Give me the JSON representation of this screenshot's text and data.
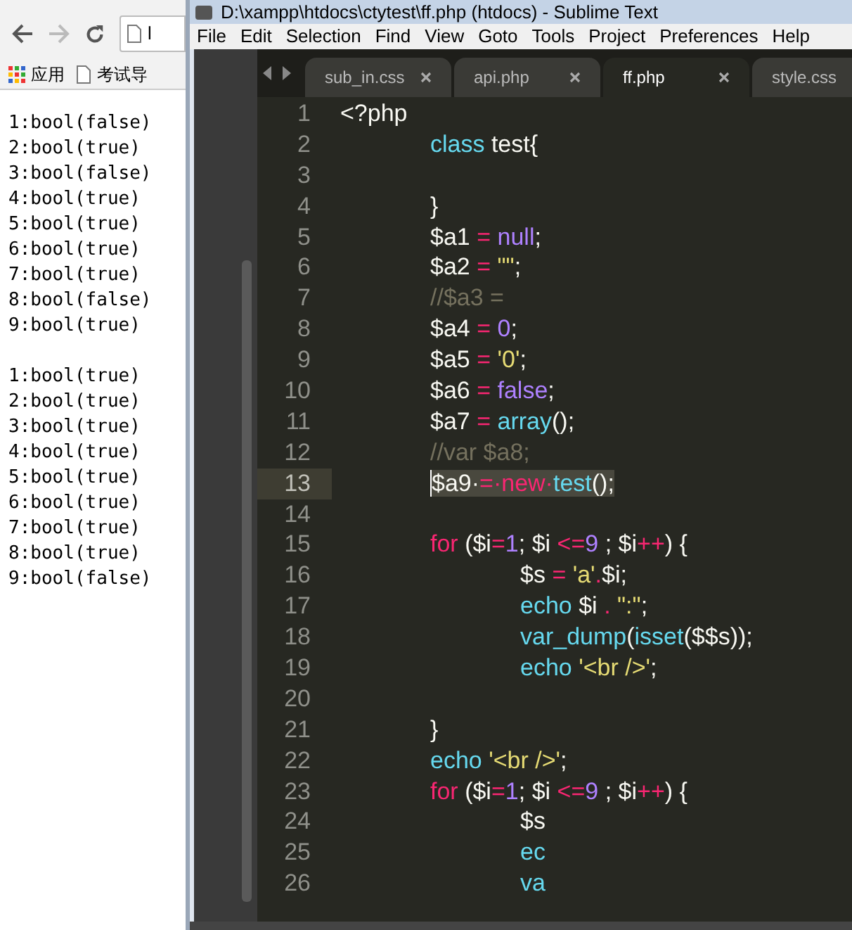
{
  "browser": {
    "url_partial": "l",
    "bookmarks": [
      {
        "label": "应用",
        "kind": "apps"
      },
      {
        "label": "考试导",
        "kind": "page"
      }
    ],
    "output_groups": [
      [
        "1:bool(false)",
        "2:bool(true)",
        "3:bool(false)",
        "4:bool(true)",
        "5:bool(true)",
        "6:bool(true)",
        "7:bool(true)",
        "8:bool(false)",
        "9:bool(true)"
      ],
      [
        "1:bool(true)",
        "2:bool(true)",
        "3:bool(true)",
        "4:bool(true)",
        "5:bool(true)",
        "6:bool(true)",
        "7:bool(true)",
        "8:bool(true)",
        "9:bool(false)"
      ]
    ]
  },
  "editor": {
    "window": {
      "title": "D:\\xampp\\htdocs\\ctytest\\ff.php (htdocs) - Sublime Text"
    },
    "menu": [
      "File",
      "Edit",
      "Selection",
      "Find",
      "View",
      "Goto",
      "Tools",
      "Project",
      "Preferences",
      "Help"
    ],
    "tabs": [
      {
        "label": "sub_in.css",
        "selected": false
      },
      {
        "label": "api.php",
        "selected": false
      },
      {
        "label": "ff.php",
        "selected": true
      },
      {
        "label": "style.css",
        "selected": false
      }
    ],
    "lines": [
      {
        "number": "1",
        "selected": false,
        "tokens": [
          {
            "text": "<?php",
            "kind": "plain"
          }
        ]
      },
      {
        "number": "2",
        "selected": false,
        "tokens": [
          {
            "text": "\tclass",
            "kind": "keyword"
          },
          {
            "text": " test{",
            "kind": "plain"
          }
        ]
      },
      {
        "number": "3",
        "selected": false
      },
      {
        "number": "4",
        "selected": false,
        "tokens": [
          {
            "text": "\t}",
            "kind": "plain"
          }
        ]
      },
      {
        "number": "5",
        "selected": false,
        "tokens": [
          {
            "text": "\t$a1 ",
            "kind": "plain"
          },
          {
            "text": "=",
            "kind": "operator"
          },
          {
            "text": " null",
            "kind": "constant"
          },
          {
            "text": ";",
            "kind": "plain"
          }
        ]
      },
      {
        "number": "6",
        "selected": false,
        "tokens": [
          {
            "text": "\t$a2 ",
            "kind": "plain"
          },
          {
            "text": "=",
            "kind": "operator"
          },
          {
            "text": " \"\"",
            "kind": "string"
          },
          {
            "text": ";",
            "kind": "plain"
          }
        ]
      },
      {
        "number": "7",
        "selected": false,
        "tokens": [
          {
            "text": "\t//$a3 =",
            "kind": "comment"
          }
        ]
      },
      {
        "number": "8",
        "selected": false,
        "tokens": [
          {
            "text": "\t$a4 ",
            "kind": "plain"
          },
          {
            "text": "=",
            "kind": "operator"
          },
          {
            "text": " 0",
            "kind": "constant"
          },
          {
            "text": ";",
            "kind": "plain"
          }
        ]
      },
      {
        "number": "9",
        "selected": false,
        "tokens": [
          {
            "text": "\t$a5 ",
            "kind": "plain"
          },
          {
            "text": "=",
            "kind": "operator"
          },
          {
            "text": " '0'",
            "kind": "string"
          },
          {
            "text": ";",
            "kind": "plain"
          }
        ]
      },
      {
        "number": "10",
        "selected": false,
        "tokens": [
          {
            "text": "\t$a6 ",
            "kind": "plain"
          },
          {
            "text": "=",
            "kind": "operator"
          },
          {
            "text": " false",
            "kind": "constant"
          },
          {
            "text": ";",
            "kind": "plain"
          }
        ]
      },
      {
        "number": "11",
        "selected": false,
        "tokens": [
          {
            "text": "\t$a7 ",
            "kind": "plain"
          },
          {
            "text": "=",
            "kind": "operator"
          },
          {
            "text": " array",
            "kind": "keyword"
          },
          {
            "text": "();",
            "kind": "plain"
          }
        ]
      },
      {
        "number": "12",
        "selected": false,
        "tokens": [
          {
            "text": "\t//var $a8;",
            "kind": "comment"
          }
        ]
      },
      {
        "number": "13",
        "selected": true,
        "tokens": [
          {
            "text": "\t$a9·",
            "kind": "plain"
          },
          {
            "text": "=·new·",
            "kind": "operator"
          },
          {
            "text": "test",
            "kind": "keyword"
          },
          {
            "text": "();",
            "kind": "plain"
          }
        ]
      },
      {
        "number": "14",
        "selected": false
      },
      {
        "number": "15",
        "selected": false,
        "tokens": [
          {
            "text": "\tfor",
            "kind": "operator"
          },
          {
            "text": " ($i",
            "kind": "plain"
          },
          {
            "text": "=",
            "kind": "operator"
          },
          {
            "text": "1",
            "kind": "constant"
          },
          {
            "text": "; $i ",
            "kind": "plain"
          },
          {
            "text": "<=",
            "kind": "operator"
          },
          {
            "text": "9",
            "kind": "constant"
          },
          {
            "text": " ; $i",
            "kind": "plain"
          },
          {
            "text": "++",
            "kind": "operator"
          },
          {
            "text": ") {",
            "kind": "plain"
          }
        ]
      },
      {
        "number": "16",
        "selected": false,
        "tokens": [
          {
            "text": "\t\t$s ",
            "kind": "plain"
          },
          {
            "text": "=",
            "kind": "operator"
          },
          {
            "text": " 'a'",
            "kind": "string"
          },
          {
            "text": ".",
            "kind": "operator"
          },
          {
            "text": "$i;",
            "kind": "plain"
          }
        ]
      },
      {
        "number": "17",
        "selected": false,
        "tokens": [
          {
            "text": "\t\techo",
            "kind": "keyword"
          },
          {
            "text": " $i ",
            "kind": "plain"
          },
          {
            "text": ".",
            "kind": "operator"
          },
          {
            "text": " \":\"",
            "kind": "string"
          },
          {
            "text": ";",
            "kind": "plain"
          }
        ]
      },
      {
        "number": "18",
        "selected": false,
        "tokens": [
          {
            "text": "\t\tvar_dump",
            "kind": "keyword"
          },
          {
            "text": "(",
            "kind": "plain"
          },
          {
            "text": "isset",
            "kind": "keyword"
          },
          {
            "text": "($$s));",
            "kind": "plain"
          }
        ]
      },
      {
        "number": "19",
        "selected": false,
        "tokens": [
          {
            "text": "\t\techo",
            "kind": "keyword"
          },
          {
            "text": " '<br />'",
            "kind": "string"
          },
          {
            "text": ";",
            "kind": "plain"
          }
        ]
      },
      {
        "number": "20",
        "selected": false
      },
      {
        "number": "21",
        "selected": false,
        "tokens": [
          {
            "text": "\t}",
            "kind": "plain"
          }
        ]
      },
      {
        "number": "22",
        "selected": false,
        "tokens": [
          {
            "text": "\techo",
            "kind": "keyword"
          },
          {
            "text": " '<br />'",
            "kind": "string"
          },
          {
            "text": ";",
            "kind": "plain"
          }
        ]
      },
      {
        "number": "23",
        "selected": false,
        "tokens": [
          {
            "text": "\tfor",
            "kind": "operator"
          },
          {
            "text": " ($i",
            "kind": "plain"
          },
          {
            "text": "=",
            "kind": "operator"
          },
          {
            "text": "1",
            "kind": "constant"
          },
          {
            "text": "; $i ",
            "kind": "plain"
          },
          {
            "text": "<=",
            "kind": "operator"
          },
          {
            "text": "9",
            "kind": "constant"
          },
          {
            "text": " ; $i",
            "kind": "plain"
          },
          {
            "text": "++",
            "kind": "operator"
          },
          {
            "text": ") {",
            "kind": "plain"
          }
        ]
      },
      {
        "number": "24",
        "selected": false,
        "tokens": [
          {
            "text": "\t\t$s",
            "kind": "plain"
          }
        ]
      },
      {
        "number": "25",
        "selected": false,
        "tokens": [
          {
            "text": "\t\tec",
            "kind": "keyword"
          }
        ]
      },
      {
        "number": "26",
        "selected": false,
        "tokens": [
          {
            "text": "\t\tva",
            "kind": "keyword"
          }
        ]
      }
    ]
  }
}
